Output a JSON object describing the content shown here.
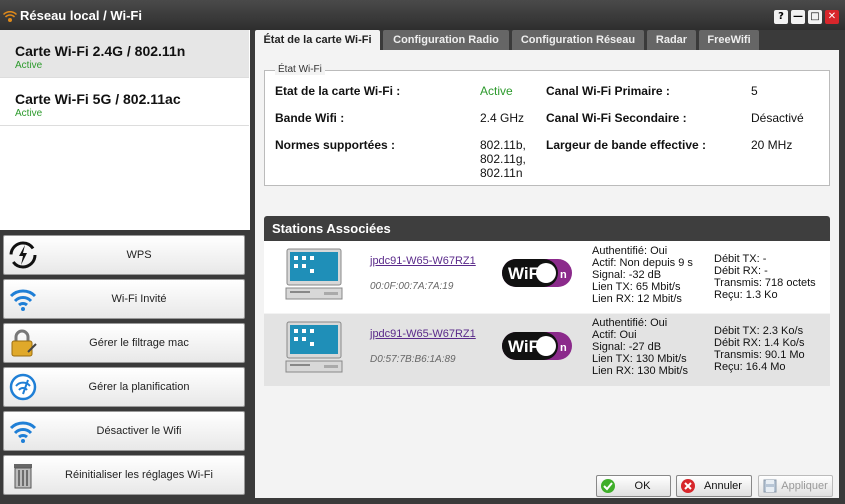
{
  "window": {
    "title": "Réseau local / Wi-Fi",
    "help": "?",
    "minimize": "—",
    "maximize": "□",
    "close": "✕"
  },
  "cards": [
    {
      "name": "Carte Wi-Fi 2.4G / 802.11n",
      "status": "Active"
    },
    {
      "name": "Carte Wi-Fi 5G / 802.11ac",
      "status": "Active"
    }
  ],
  "actions": [
    {
      "label": "WPS",
      "icon": "wps-icon"
    },
    {
      "label": "Wi-Fi Invité",
      "icon": "wifi-icon"
    },
    {
      "label": "Gérer le filtrage mac",
      "icon": "lock-icon"
    },
    {
      "label": "Gérer la planification",
      "icon": "schedule-icon"
    },
    {
      "label": "Désactiver le Wifi",
      "icon": "wifi-icon"
    },
    {
      "label": "Réinitialiser les réglages Wi-Fi",
      "icon": "trash-icon"
    }
  ],
  "tabs": [
    {
      "label": "État de la carte Wi-Fi",
      "active": true
    },
    {
      "label": "Configuration Radio",
      "active": false
    },
    {
      "label": "Configuration Réseau",
      "active": false
    },
    {
      "label": "Radar",
      "active": false
    },
    {
      "label": "FreeWifi",
      "active": false
    }
  ],
  "status": {
    "legend": "État Wi-Fi",
    "etat_label": "Etat de la carte Wi-Fi :",
    "etat_value": "Active",
    "bande_label": "Bande Wifi :",
    "bande_value": "2.4 GHz",
    "normes_label": "Normes supportées :",
    "normes_value": [
      "802.11b,",
      "802.11g,",
      "802.11n"
    ],
    "canal_primaire_label": "Canal Wi-Fi Primaire :",
    "canal_primaire_value": "5",
    "canal_secondaire_label": "Canal Wi-Fi Secondaire :",
    "canal_secondaire_value": "Désactivé",
    "largeur_label": "Largeur de bande effective :",
    "largeur_value": "20 MHz"
  },
  "stations": {
    "title": "Stations Associées",
    "logo_text": "WiFi",
    "logo_badge": "n",
    "rows": [
      {
        "host": "jpdc91-W65-W67RZ1",
        "mac": "00:0F:00:7A:7A:19",
        "info": [
          "Authentifié: Oui",
          "Actif: Non depuis 9 s",
          "Signal: -32 dB",
          "Lien TX: 65 Mbit/s",
          "Lien RX: 12 Mbit/s"
        ],
        "traffic": [
          "Débit TX: -",
          "Débit RX: -",
          "Transmis: 718 octets",
          "Reçu: 1.3 Ko"
        ]
      },
      {
        "host": "jpdc91-W65-W67RZ1",
        "mac": "D0:57:7B:B6:1A:89",
        "info": [
          "Authentifié: Oui",
          "Actif: Oui",
          "Signal: -27 dB",
          "Lien TX: 130 Mbit/s",
          "Lien RX: 130 Mbit/s"
        ],
        "traffic": [
          "Débit TX: 2.3 Ko/s",
          "Débit RX: 1.4 Ko/s",
          "Transmis: 90.1 Mo",
          "Reçu: 16.4 Mo"
        ]
      }
    ]
  },
  "buttons": {
    "ok": "OK",
    "cancel": "Annuler",
    "apply": "Appliquer"
  },
  "colors": {
    "active_green": "#2c9a2c",
    "close_red": "#d7262b",
    "wifi_blue": "#1f7fd6",
    "logo_purple": "#8b2a8b"
  }
}
